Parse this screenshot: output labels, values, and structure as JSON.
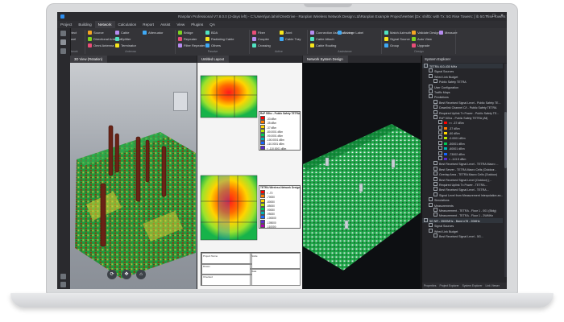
{
  "window": {
    "title": "Ranplan Professional V7.8.0.0 (2-days left) - C:\\Users\\jun.lahiri\\OneDrive - Ranplan Wireless Network Design Ltd\\Ranplan Example Project\\HetNet [Dx: shiftb: with Tx: 5G Rise Towers: ] \\b 5G Rise Towers *"
  },
  "menu": {
    "items": [
      "Project",
      "Building",
      "Network",
      "Calculation",
      "Report",
      "Assist",
      "View",
      "Plugins",
      "QA"
    ],
    "active": "Network"
  },
  "ribbon": {
    "groups": [
      {
        "label": "Network",
        "buttons": [
          "Select",
          "Panel"
        ]
      },
      {
        "label": "Antenna",
        "buttons": [
          "Source",
          "Directional Antenna",
          "Omni Antenna",
          "Cable",
          "Splitter",
          "Terminator",
          "Attenuator"
        ]
      },
      {
        "label": "Passive",
        "buttons": [
          "Bridge",
          "Repeater",
          "Filter Repeater",
          "BDA",
          "Radiating Cable",
          "Others"
        ]
      },
      {
        "label": "Active",
        "buttons": [
          "Fiber",
          "Coupler",
          "Crossing",
          "Joint",
          "Cable Tray"
        ]
      },
      {
        "label": "Assistance",
        "buttons": [
          "Connection Assistant Line",
          "Cable Attach",
          "Cable Routing",
          "Arrange Label"
        ]
      },
      {
        "label": "Design",
        "buttons": [
          "Match Azimuth",
          "Signal Source",
          "Group",
          "Validate Design",
          "Auto View",
          "Upgrade",
          "Measure"
        ]
      }
    ]
  },
  "view_tabs": {
    "view3d": "3D View (Rotation)",
    "view2d": "Untitled Layout",
    "network": "Network System Design",
    "explorer": "System Explorer"
  },
  "floorplan_legend_top": {
    "header": "RxP 5Ghz - Public Safety TETRA",
    "rows": [
      {
        "label": "-33 dBm",
        "color": "#ff0000"
      },
      {
        "label": "-35 dBm",
        "color": "#ff7a00"
      },
      {
        "label": "-37 dBm",
        "color": "#ffd400"
      },
      {
        "label": "-80.0001 dBm",
        "color": "#b8e600"
      },
      {
        "label": "-90.0001 dBm",
        "color": "#00c853"
      },
      {
        "label": "-100.0001 dBm",
        "color": "#00b3b3"
      },
      {
        "label": "-110.0001 dBm",
        "color": "#1565ff"
      },
      {
        "label": "< -110.0001 dBm",
        "color": "#5a2cc9"
      }
    ]
  },
  "floorplan_legend_bottom": {
    "header": "TETRA Wireless Network Design",
    "rows": [
      {
        "label": "< -70",
        "color": "#ff0000"
      },
      {
        "label": "-70000",
        "color": "#ff7a00"
      },
      {
        "label": "-80000",
        "color": "#ffd400"
      },
      {
        "label": "-85000",
        "color": "#b8e600"
      },
      {
        "label": "-90000",
        "color": "#00c853"
      },
      {
        "label": "-95000",
        "color": "#00b3b3"
      },
      {
        "label": "-100000",
        "color": "#1565ff"
      },
      {
        "label": "-105000",
        "color": "#5a2cc9"
      },
      {
        "label": "-110000",
        "color": "#b000b0"
      }
    ]
  },
  "title_block": {
    "project": "Project Name",
    "drawn": "Drawn",
    "checked": "Checked",
    "scale": "Scale",
    "date": "Date"
  },
  "explorer": {
    "title": "System Explorer",
    "nodes": [
      {
        "label": "TETRA 410-430 MHz",
        "level": 0
      },
      {
        "label": "Signal Sources",
        "level": 1
      },
      {
        "label": "Wired Link Budget",
        "level": 1
      },
      {
        "label": "Public Safety TETRA",
        "level": 2
      },
      {
        "label": "User Configuration",
        "level": 1
      },
      {
        "label": "Traffic Maps",
        "level": 1
      },
      {
        "label": "Predictions",
        "level": 1
      },
      {
        "label": "Best Received Signal Level - Public Safety TE...",
        "level": 2
      },
      {
        "label": "Downlink Channel C/I - Public Safety TETRA",
        "level": 2
      },
      {
        "label": "Required Uplink Tx Power - Public Safety TE...",
        "level": 2
      },
      {
        "label": "RxP 5Ghz - Public Safety TETRA (All)",
        "level": 2
      },
      {
        "label": ">= -37 dBm",
        "level": 3,
        "color": "#ff0000"
      },
      {
        "label": "-37 dBm",
        "level": 3,
        "color": "#ff7a00"
      },
      {
        "label": "-60 dBm",
        "level": 3,
        "color": "#ffd400"
      },
      {
        "label": "-0.0001 dBm",
        "level": 3,
        "color": "#b8e600"
      },
      {
        "label": "-50001 dBm",
        "level": 3,
        "color": "#00c853"
      },
      {
        "label": "-60001 dBm",
        "level": 3,
        "color": "#00b3b3"
      },
      {
        "label": "-73002 dBm",
        "level": 3,
        "color": "#1565ff"
      },
      {
        "label": "< -113.5 dBm",
        "level": 3,
        "color": "#5a2cc9"
      },
      {
        "label": "Best Received Signal Level - TETRA Macro ...",
        "level": 2
      },
      {
        "label": "Best Server - TETRA Macro Cells (Outdoor...",
        "level": 2
      },
      {
        "label": "Overlap Area - TETRA Macro Cells (Outdoor)",
        "level": 2
      },
      {
        "label": "Best Received Signal Level (Outdoor) (...",
        "level": 2
      },
      {
        "label": "Required Uplink Tx Power - TETRA...",
        "level": 2
      },
      {
        "label": "Best Received Signal Level - TETRA...",
        "level": 2
      },
      {
        "label": "Signal Level from Measurement Interpolation an...",
        "level": 2
      },
      {
        "label": "Simulations",
        "level": 1
      },
      {
        "label": "Measurements",
        "level": 1
      },
      {
        "label": "Measurement - TETRA - Floor 1 - 001 (Bldg)",
        "level": 2
      },
      {
        "label": "Measurement - TETRA - Floor 1 - 2WMHz",
        "level": 2
      },
      {
        "label": "5G NR - 3500MHz - Band n78 - 20MHz",
        "level": 0
      },
      {
        "label": "Signal Sources",
        "level": 1
      },
      {
        "label": "Wired Link Budget",
        "level": 1
      },
      {
        "label": "Best Received Signal Level - 5G...",
        "level": 2
      }
    ],
    "bottom_tabs": [
      "Properties",
      "Project Explorer",
      "System Explorer",
      "Link Viewer"
    ]
  },
  "colors": {
    "accent": "#2d8ff0",
    "sea": "#1fa84a",
    "building": "#7a2e12"
  }
}
